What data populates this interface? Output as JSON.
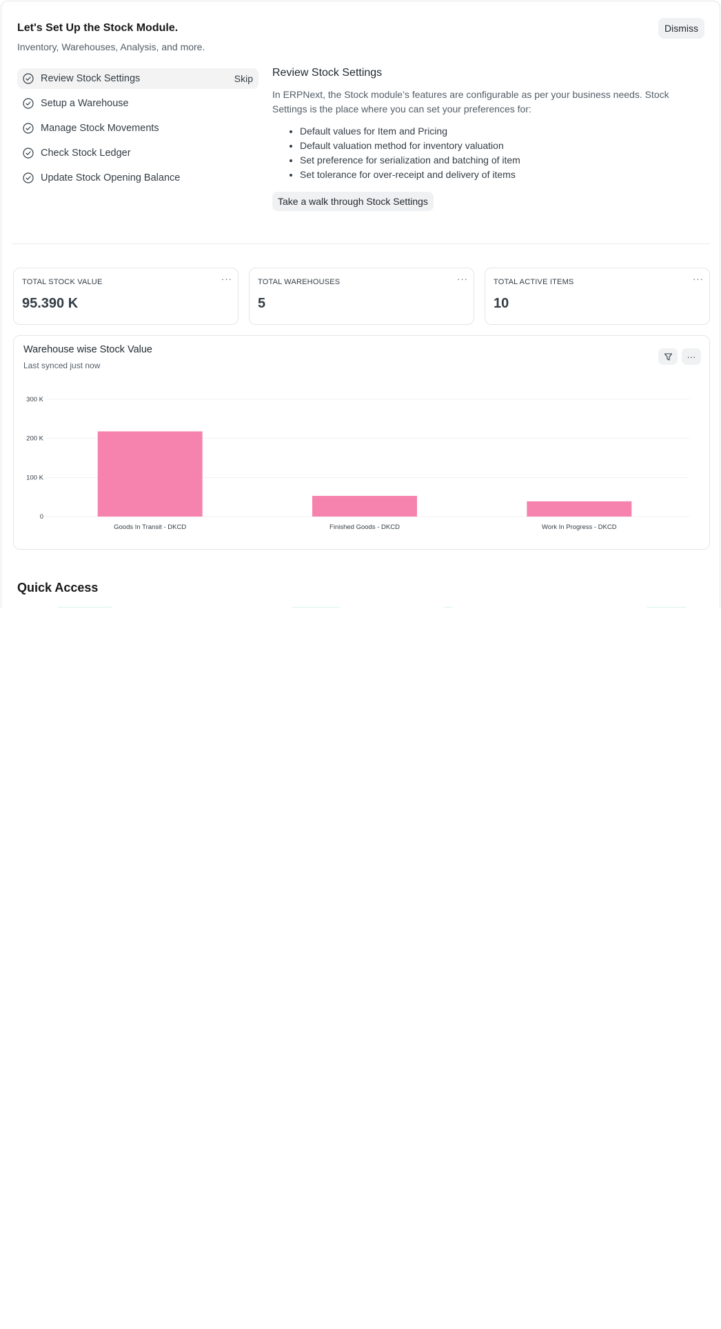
{
  "onboarding": {
    "title": "Let's Set Up the Stock Module.",
    "subtitle": "Inventory, Warehouses, Analysis, and more.",
    "dismiss_label": "Dismiss",
    "steps": [
      {
        "label": "Review Stock Settings",
        "skip": "Skip"
      },
      {
        "label": "Setup a Warehouse"
      },
      {
        "label": "Manage Stock Movements"
      },
      {
        "label": "Check Stock Ledger"
      },
      {
        "label": "Update Stock Opening Balance"
      }
    ],
    "detail": {
      "title": "Review Stock Settings",
      "text": "In ERPNext, the Stock module’s features are configurable as per your business needs. Stock Settings is the place where you can set your preferences for:",
      "bullets": [
        "Default values for Item and Pricing",
        "Default valuation method for inventory valuation",
        "Set preference for serialization and batching of item",
        "Set tolerance for over-receipt and delivery of items"
      ],
      "button_label": "Take a walk through Stock Settings"
    }
  },
  "number_cards": [
    {
      "label": "TOTAL STOCK VALUE",
      "value": "95.390 K",
      "menu": "···"
    },
    {
      "label": "TOTAL WAREHOUSES",
      "value": "5",
      "menu": "···"
    },
    {
      "label": "TOTAL ACTIVE ITEMS",
      "value": "10",
      "menu": "···"
    }
  ],
  "chart_card": {
    "title": "Warehouse wise Stock Value",
    "subtitle": "Last synced just now",
    "filter_icon": "filter-icon",
    "menu_icon": "more-icon",
    "menu": "···"
  },
  "chart_data": {
    "type": "bar",
    "categories": [
      "Goods In Transit - DKCD",
      "Finished Goods - DKCD",
      "Work In Progress - DKCD"
    ],
    "values": [
      218000,
      53000,
      39000
    ],
    "y_ticks": [
      0,
      100000,
      200000,
      300000
    ],
    "y_tick_labels": [
      "0",
      "100 K",
      "200 K",
      "300 K"
    ],
    "ylim": [
      0,
      300000
    ],
    "grid": true,
    "bar_color": "#f683ae"
  },
  "quick_access": {
    "title": "Quick Access"
  },
  "colors": {
    "accent_bar": "#f683ae",
    "button_bg": "#f0f1f2",
    "border": "#e2e6e9"
  }
}
